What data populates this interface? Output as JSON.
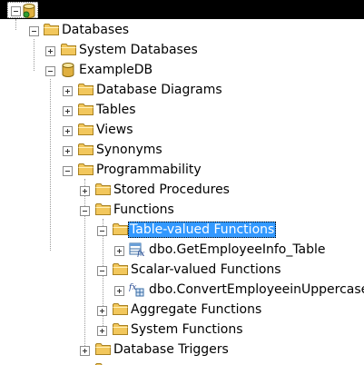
{
  "tree": {
    "databases": "Databases",
    "system_databases": "System Databases",
    "example_db": "ExampleDB",
    "database_diagrams": "Database Diagrams",
    "tables": "Tables",
    "views": "Views",
    "synonyms": "Synonyms",
    "programmability": "Programmability",
    "stored_procedures": "Stored Procedures",
    "functions": "Functions",
    "table_valued_functions": "Table-valued Functions",
    "get_employee_info_table": "dbo.GetEmployeeInfo_Table",
    "scalar_valued_functions": "Scalar-valued Functions",
    "convert_employee_uppercase": "dbo.ConvertEmployeeinUppercase",
    "aggregate_functions": "Aggregate Functions",
    "system_functions": "System Functions",
    "database_triggers": "Database Triggers"
  },
  "colors": {
    "selection": "#3399ff",
    "folder": "#f2c75c",
    "database": "#e0b040"
  }
}
